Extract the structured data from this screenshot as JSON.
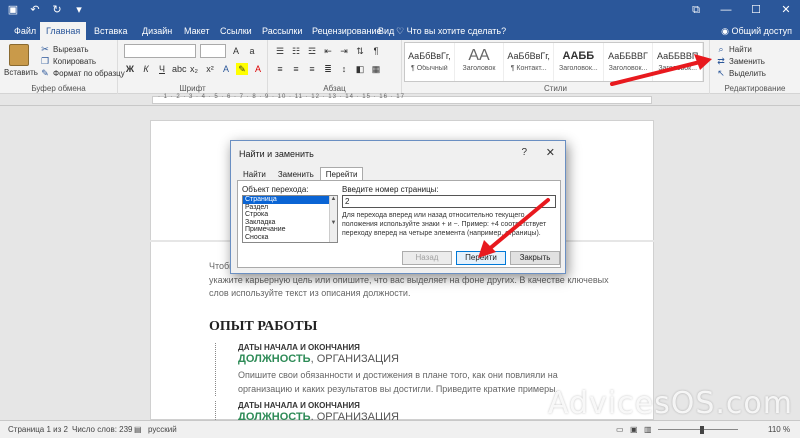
{
  "titlebar": {
    "qat": [
      "save-icon",
      "undo-icon",
      "redo-icon",
      "customize-icon"
    ]
  },
  "tabs": [
    "Файл",
    "Главная",
    "Вставка",
    "Дизайн",
    "Макет",
    "Ссылки",
    "Рассылки",
    "Рецензирование",
    "Вид"
  ],
  "active_tab": "Главная",
  "tell_me": "Что вы хотите сделать?",
  "share": "Общий доступ",
  "ribbon": {
    "clipboard": {
      "paste": "Вставить",
      "cut": "Вырезать",
      "copy": "Копировать",
      "format_painter": "Формат по образцу",
      "label": "Буфер обмена"
    },
    "font": {
      "label": "Шрифт",
      "bold": "Ж",
      "italic": "К",
      "underline": "Ч"
    },
    "paragraph": {
      "label": "Абзац"
    },
    "styles": {
      "label": "Стили",
      "items": [
        {
          "sample": "АаБбВвГг,",
          "name": "¶ Обычный"
        },
        {
          "sample": "АА",
          "name": "Заголовок"
        },
        {
          "sample": "АаБбВвГг,",
          "name": "¶ Контакт..."
        },
        {
          "sample": "ААББ",
          "name": "Заголовок..."
        },
        {
          "sample": "АаББВВГ",
          "name": "Заголовок..."
        },
        {
          "sample": "АаББВВП",
          "name": "Заголовок..."
        }
      ]
    },
    "editing": {
      "label": "Редактирование",
      "find": "Найти",
      "replace": "Заменить",
      "select": "Выделить"
    }
  },
  "document": {
    "intro_cut": "Чтобы",
    "line1": "укажите карьерную цель или опишите, что вас выделяет на фоне других. В качестве ключевых",
    "line2": "слов используйте текст из описания должности.",
    "heading": "ОПЫТ РАБОТЫ",
    "entries": [
      {
        "dates": "ДАТЫ НАЧАЛА И ОКОНЧАНИЯ",
        "position": "ДОЛЖНОСТЬ",
        "org": ", ОРГАНИЗАЦИЯ",
        "desc1": "Опишите свои обязанности и достижения в плане того, как они повлияли на",
        "desc2": "организацию и каких результатов вы достигли. Приведите краткие примеры."
      },
      {
        "dates": "ДАТЫ НАЧАЛА И ОКОНЧАНИЯ",
        "position": "ДОЛЖНОСТЬ",
        "org": ", ОРГАНИЗАЦИЯ"
      }
    ]
  },
  "dialog": {
    "title": "Найти и заменить",
    "help": "?",
    "close": "✕",
    "tabs": [
      "Найти",
      "Заменить",
      "Перейти"
    ],
    "active_tab": "Перейти",
    "goto_what_label": "Объект перехода:",
    "goto_items": [
      "Страница",
      "Раздел",
      "Строка",
      "Закладка",
      "Примечание",
      "Сноска"
    ],
    "selected_item": "Страница",
    "page_number_label": "Введите номер страницы:",
    "page_number_value": "2",
    "help_text": "Для перехода вперед или назад относительно текущего положения используйте знаки + и −. Пример: +4 соответствует переходу вперед на четыре элемента (например, страницы).",
    "btn_prev": "Назад",
    "btn_goto": "Перейти",
    "btn_close": "Закрыть"
  },
  "status": {
    "page": "Страница 1 из 2",
    "words": "Число слов: 239",
    "language": "русский",
    "zoom": "110 %"
  },
  "watermark": "AdvicesOS.com",
  "colors": {
    "accent": "#2b579a",
    "green": "#2e8b57",
    "arrow": "#e8191e"
  }
}
